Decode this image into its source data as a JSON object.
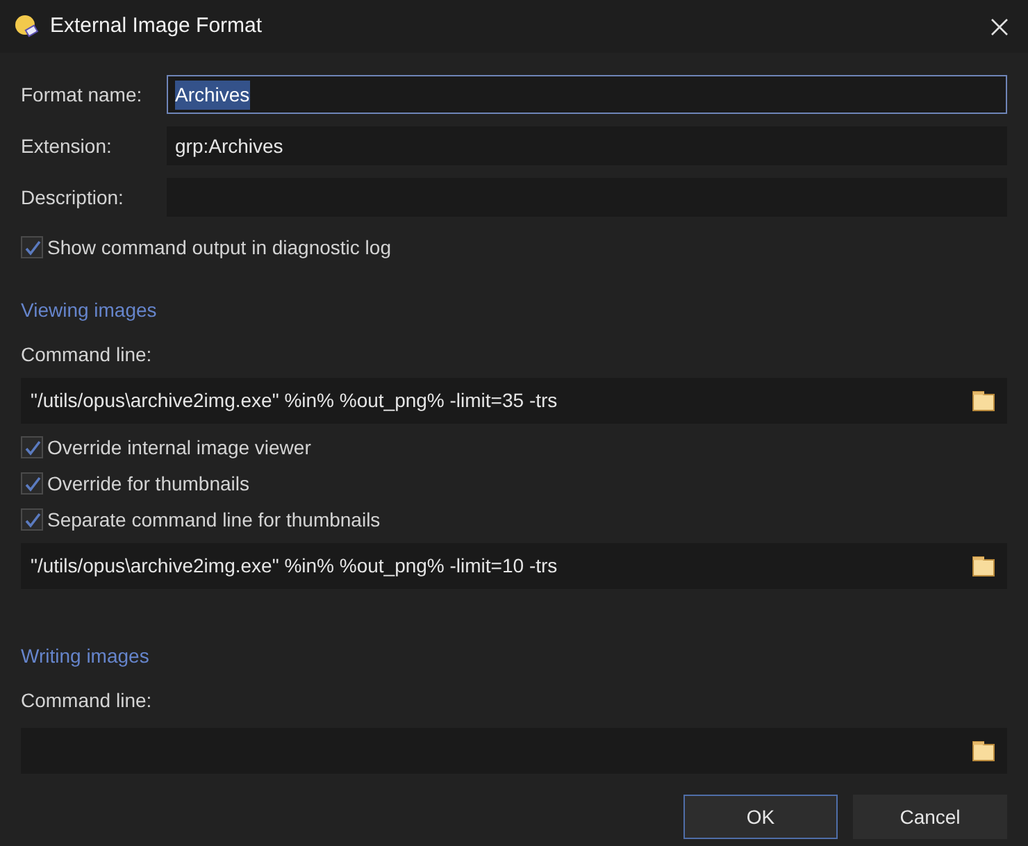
{
  "window": {
    "title": "External Image Format"
  },
  "fields": [
    {
      "label": "Format name:",
      "value": "Archives",
      "focused": true,
      "text_selected": true
    },
    {
      "label": "Extension:",
      "value": "grp:Archives",
      "focused": false
    },
    {
      "label": "Description:",
      "focused": false
    }
  ],
  "show_output": {
    "label": "Show command output in diagnostic log",
    "checked": true
  },
  "viewing": {
    "heading": "Viewing images",
    "command_label": "Command line:",
    "command": "\"/utils/opus\\archive2img.exe\" %in% %out_png% -limit=35 -trs",
    "options": [
      {
        "label": "Override internal image viewer",
        "checked": true
      },
      {
        "label": "Override for thumbnails",
        "checked": true
      },
      {
        "label": "Separate command line for thumbnails",
        "checked": true
      }
    ],
    "thumbnail_command": "\"/utils/opus\\archive2img.exe\" %in% %out_png% -limit=10 -trs"
  },
  "writing": {
    "heading": "Writing images",
    "command_label": "Command line:"
  },
  "buttons": [
    {
      "label": "OK",
      "default": true
    },
    {
      "label": "Cancel",
      "default": false
    }
  ]
}
